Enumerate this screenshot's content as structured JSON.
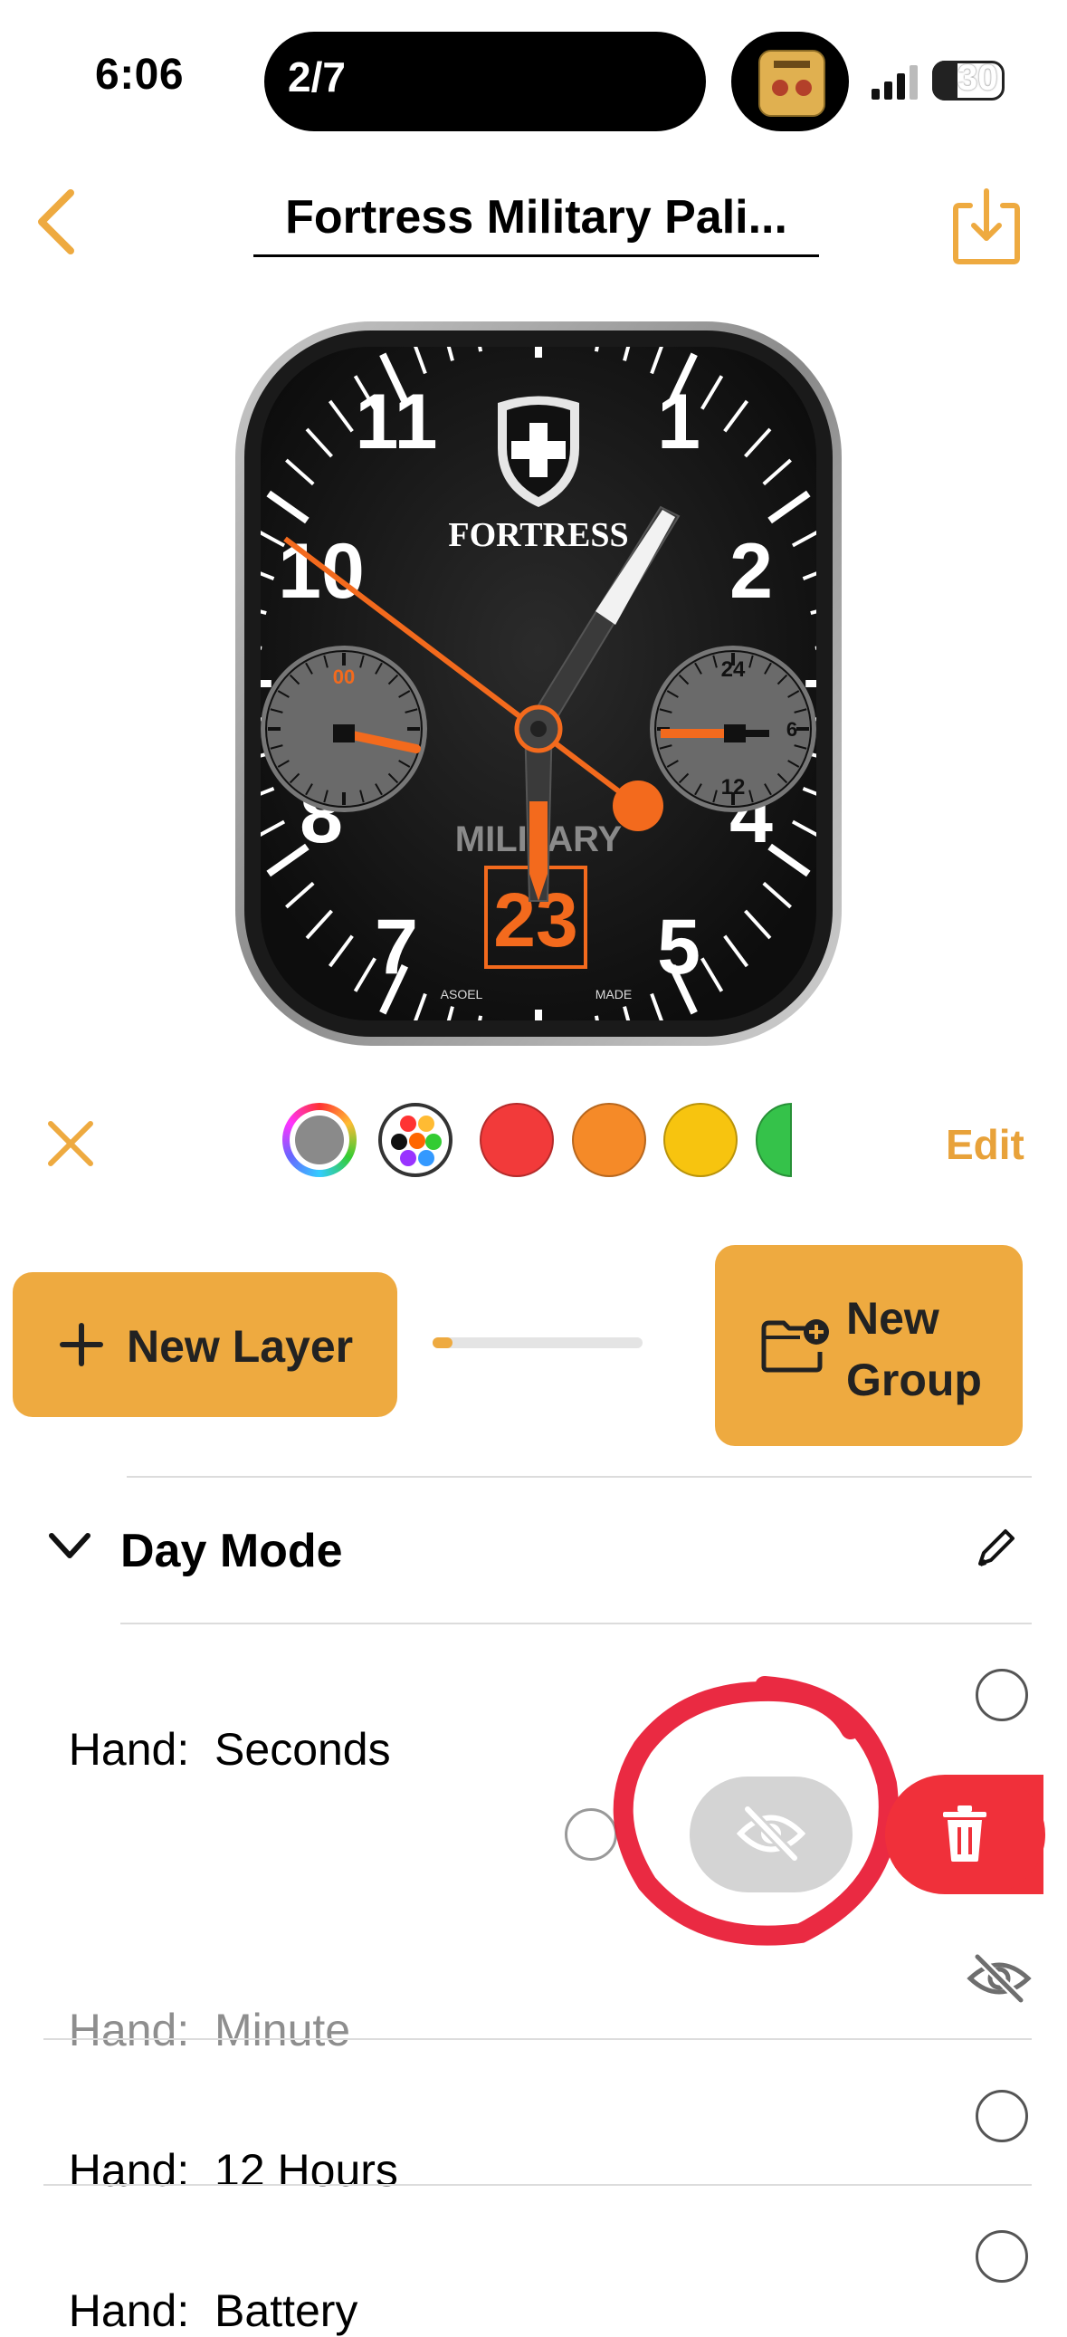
{
  "status": {
    "time": "6:06",
    "island_text": "2/7",
    "battery": "30",
    "badge_icon": "app-badge-icon"
  },
  "nav": {
    "back_icon": "chevron-left-icon",
    "title": "Fortress Military Pali...",
    "export_icon": "download-tray-icon"
  },
  "watch_face": {
    "brand": "FORTRESS",
    "subtitle": "MILITARY",
    "date": "23",
    "hour_numerals": [
      "11",
      "1",
      "10",
      "2",
      "8",
      "4",
      "7",
      "5"
    ],
    "subdial_left_label": "00",
    "subdial_right_labels": [
      "24",
      "6",
      "12"
    ],
    "small_left": "ASOEL",
    "small_right": "MADE"
  },
  "palette": {
    "close_icon": "close-icon",
    "colors": [
      "#8a8a8a",
      "multicolor",
      "#f23a3a",
      "#f58a28",
      "#f7c40f",
      "#35c24a"
    ],
    "edit_label": "Edit"
  },
  "actions": {
    "new_layer_label": "New Layer",
    "new_group_line1": "New",
    "new_group_line2": "Group",
    "slider_value": 0.08
  },
  "layers": {
    "section_title": "Day Mode",
    "rows": [
      {
        "prefix": "Hand:",
        "name": "Seconds",
        "state": "radio"
      },
      {
        "prefix": "Hand:",
        "name": "Minute",
        "state": "hidden"
      },
      {
        "prefix": "Hand:",
        "name": "12 Hours",
        "state": "radio"
      },
      {
        "prefix": "Hand:",
        "name": "Battery",
        "state": "radio"
      }
    ],
    "swipe_actions": [
      "hide-eye-slash-icon",
      "trash-icon"
    ]
  },
  "accent": "#eeaa40"
}
